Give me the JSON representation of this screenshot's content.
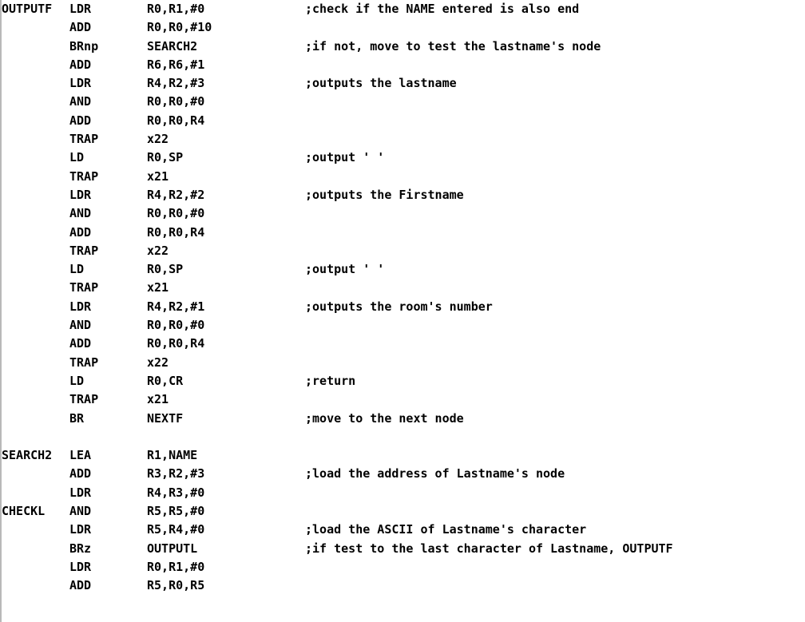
{
  "lines": [
    {
      "label": "OUTPUTF",
      "op": "LDR",
      "operand": "R0,R1,#0",
      "comment": ";check if the NAME entered is also end"
    },
    {
      "label": "",
      "op": "ADD",
      "operand": "R0,R0,#10",
      "comment": ""
    },
    {
      "label": "",
      "op": "BRnp",
      "operand": "SEARCH2",
      "comment": ";if not, move to test the lastname's node"
    },
    {
      "label": "",
      "op": "ADD",
      "operand": "R6,R6,#1",
      "comment": ""
    },
    {
      "label": "",
      "op": "LDR",
      "operand": "R4,R2,#3",
      "comment": ";outputs the lastname"
    },
    {
      "label": "",
      "op": "AND",
      "operand": "R0,R0,#0",
      "comment": ""
    },
    {
      "label": "",
      "op": "ADD",
      "operand": "R0,R0,R4",
      "comment": ""
    },
    {
      "label": "",
      "op": "TRAP",
      "operand": "x22",
      "comment": ""
    },
    {
      "label": "",
      "op": "LD",
      "operand": "R0,SP",
      "comment": ";output ' '"
    },
    {
      "label": "",
      "op": "TRAP",
      "operand": "x21",
      "comment": ""
    },
    {
      "label": "",
      "op": "LDR",
      "operand": "R4,R2,#2",
      "comment": ";outputs the Firstname"
    },
    {
      "label": "",
      "op": "AND",
      "operand": "R0,R0,#0",
      "comment": ""
    },
    {
      "label": "",
      "op": "ADD",
      "operand": "R0,R0,R4",
      "comment": ""
    },
    {
      "label": "",
      "op": "TRAP",
      "operand": "x22",
      "comment": ""
    },
    {
      "label": "",
      "op": "LD",
      "operand": "R0,SP",
      "comment": ";output ' '"
    },
    {
      "label": "",
      "op": "TRAP",
      "operand": "x21",
      "comment": ""
    },
    {
      "label": "",
      "op": "LDR",
      "operand": "R4,R2,#1",
      "comment": ";outputs the room's number"
    },
    {
      "label": "",
      "op": "AND",
      "operand": "R0,R0,#0",
      "comment": ""
    },
    {
      "label": "",
      "op": "ADD",
      "operand": "R0,R0,R4",
      "comment": ""
    },
    {
      "label": "",
      "op": "TRAP",
      "operand": "x22",
      "comment": ""
    },
    {
      "label": "",
      "op": "LD",
      "operand": "R0,CR",
      "comment": ";return"
    },
    {
      "label": "",
      "op": "TRAP",
      "operand": "x21",
      "comment": ""
    },
    {
      "label": "",
      "op": "BR",
      "operand": "NEXTF",
      "comment": ";move to the next node"
    },
    {
      "label": "",
      "op": "",
      "operand": "",
      "comment": ""
    },
    {
      "label": "SEARCH2",
      "op": "LEA",
      "operand": "R1,NAME",
      "comment": ""
    },
    {
      "label": "",
      "op": "ADD",
      "operand": "R3,R2,#3",
      "comment": ";load the address of Lastname's node"
    },
    {
      "label": "",
      "op": "LDR",
      "operand": "R4,R3,#0",
      "comment": ""
    },
    {
      "label": "CHECKL",
      "op": "AND",
      "operand": "R5,R5,#0",
      "comment": ""
    },
    {
      "label": "",
      "op": "LDR",
      "operand": "R5,R4,#0",
      "comment": ";load the ASCII of Lastname's character"
    },
    {
      "label": "",
      "op": "BRz",
      "operand": "OUTPUTL",
      "comment": ";if test to the last character of Lastname, OUTPUTF"
    },
    {
      "label": "",
      "op": "LDR",
      "operand": "R0,R1,#0",
      "comment": ""
    },
    {
      "label": "",
      "op": "ADD",
      "operand": "R5,R0,R5",
      "comment": ""
    }
  ]
}
